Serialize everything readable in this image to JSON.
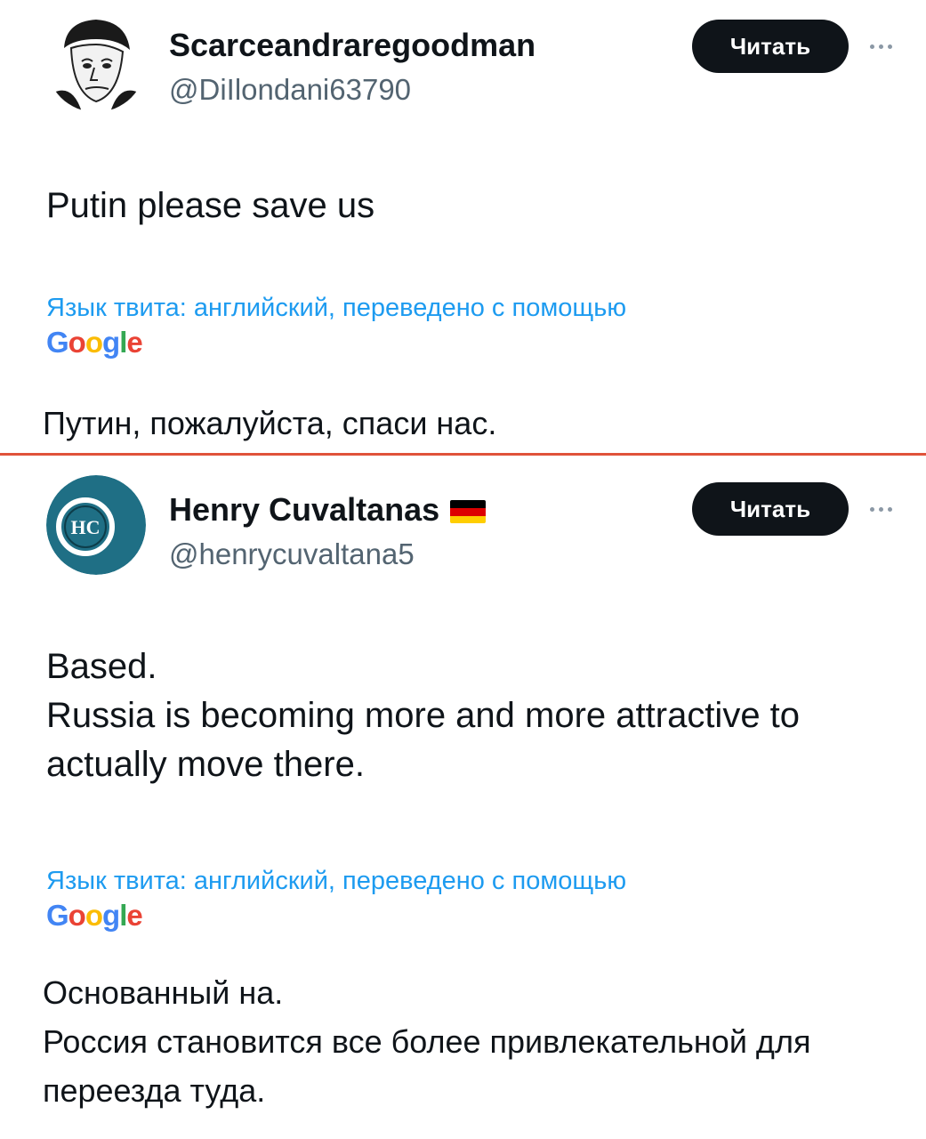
{
  "tweets": [
    {
      "display_name": "Scarceandraregoodman",
      "handle": "@DiIlondani63790",
      "follow_label": "Читать",
      "text": "Putin please save us",
      "translation_label": "Язык твита: английский, переведено с помощью",
      "translation_provider": "Google",
      "translated_text": "Путин, пожалуйста, спаси нас."
    },
    {
      "display_name": "Henry Cuvaltanas",
      "flag_icon": "germany-flag-icon",
      "avatar_initials": "HC",
      "handle": "@henrycuvaltana5",
      "follow_label": "Читать",
      "text": "Based.\nRussia is becoming more and more attractive to actually move there.",
      "translation_label": "Язык твита: английский, переведено с помощью",
      "translation_provider": "Google",
      "translated_text": "Основанный на.\nРоссия становится все более привлекательной для переезда туда."
    }
  ],
  "colors": {
    "link_blue": "#1d9bf0",
    "button_bg": "#0f1419",
    "divider": "#e0533a",
    "handle_gray": "#536471",
    "google_blue": "#4285f4",
    "google_red": "#ea4335",
    "google_yellow": "#fbbc05",
    "google_green": "#34a853",
    "avatar2_bg": "#1f6f85"
  }
}
